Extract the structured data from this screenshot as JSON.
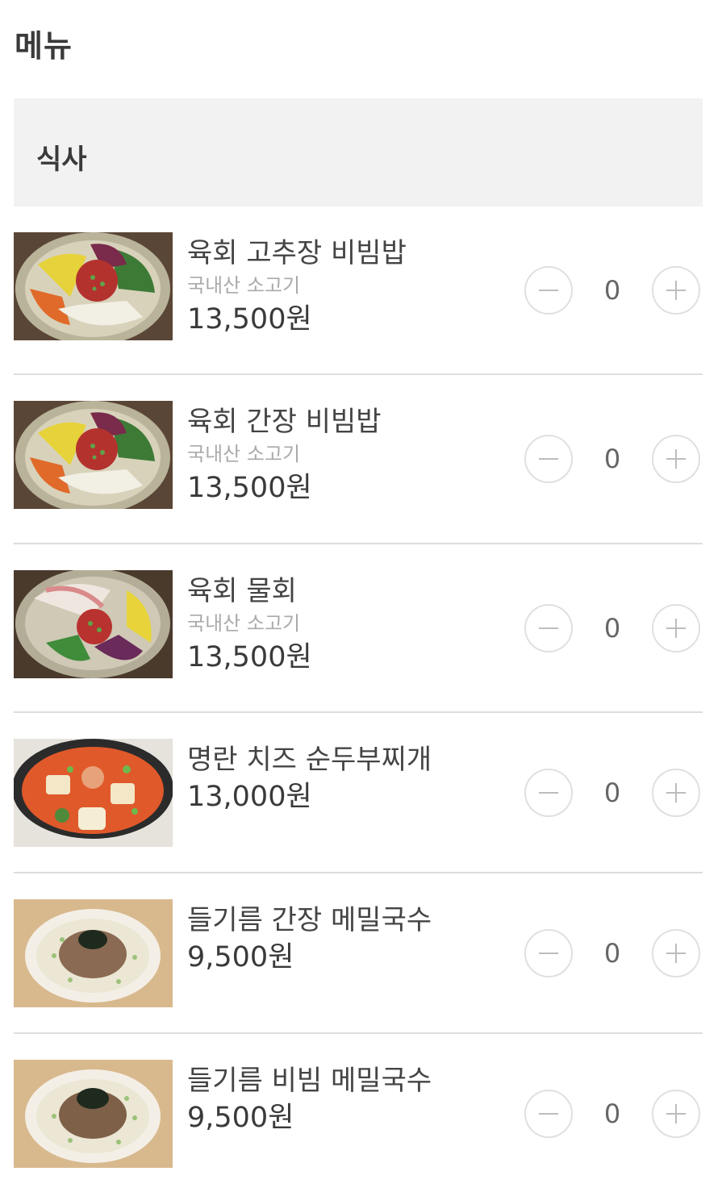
{
  "header": {
    "title": "메뉴"
  },
  "section": {
    "title": "식사"
  },
  "colors": {
    "section_bg": "#f2f2f2",
    "divider": "#dddddd",
    "stepper_border": "#e0e0e0",
    "desc_text": "#aaaaaa"
  },
  "items": [
    {
      "name": "육회 고추장 비빔밥",
      "desc": "국내산 소고기",
      "price": "13,500원",
      "qty": "0",
      "image_icon": "bibimbap-photo"
    },
    {
      "name": "육회 간장 비빔밥",
      "desc": "국내산 소고기",
      "price": "13,500원",
      "qty": "0",
      "image_icon": "bibimbap-photo"
    },
    {
      "name": "육회 물회",
      "desc": "국내산 소고기",
      "price": "13,500원",
      "qty": "0",
      "image_icon": "mulhoe-photo"
    },
    {
      "name": "명란 치즈 순두부찌개",
      "price": "13,000원",
      "qty": "0",
      "image_icon": "sundubu-stew-photo"
    },
    {
      "name": "들기름 간장 메밀국수",
      "price": "9,500원",
      "qty": "0",
      "image_icon": "buckwheat-noodle-photo"
    },
    {
      "name": "들기름 비빔 메밀국수",
      "price": "9,500원",
      "qty": "0",
      "image_icon": "buckwheat-noodle-photo"
    }
  ],
  "stepper": {
    "minus_icon": "minus-icon",
    "plus_icon": "plus-icon"
  }
}
